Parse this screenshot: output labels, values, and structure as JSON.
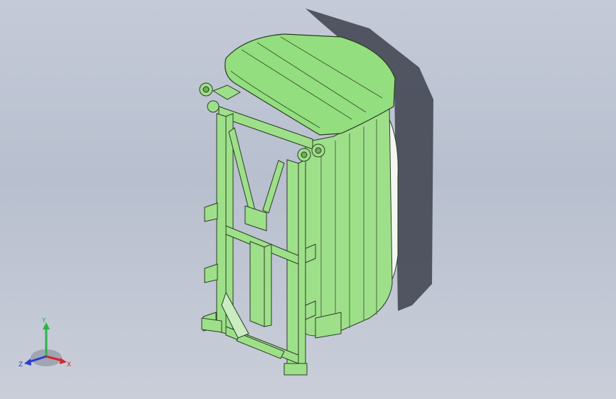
{
  "viewport": {
    "background_top": "#c4cad8",
    "background_bottom": "#c9ced9"
  },
  "model": {
    "body_color": "#9ee08a",
    "edge_color": "#2a3b23",
    "shadow_color": "#3d414d",
    "lid_color": "#93de7e"
  },
  "triad": {
    "x_label": "X",
    "y_label": "Y",
    "z_label": "Z",
    "x_color": "#d8262b",
    "y_color": "#2bb34a",
    "z_color": "#2a3fd0"
  }
}
